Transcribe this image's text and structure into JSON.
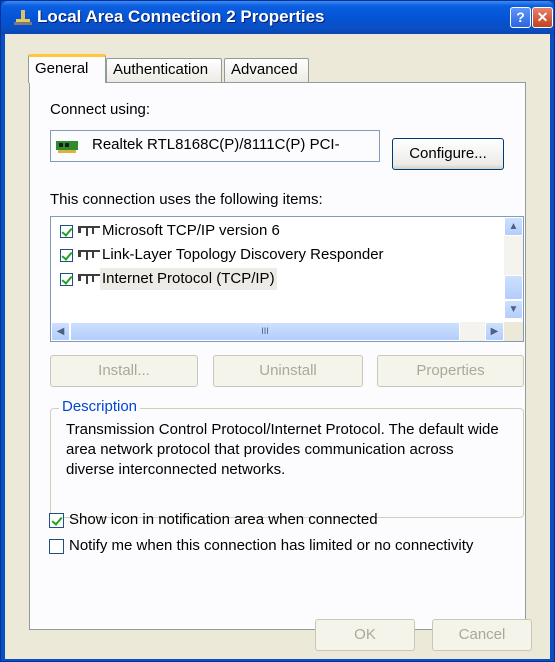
{
  "window": {
    "title": "Local Area Connection 2 Properties",
    "help_label": "?",
    "close_label": "✕"
  },
  "tabs": [
    {
      "label": "General",
      "active": true
    },
    {
      "label": "Authentication",
      "active": false
    },
    {
      "label": "Advanced",
      "active": false
    }
  ],
  "general": {
    "connect_using_label": "Connect using:",
    "device_name": "Realtek RTL8168C(P)/8111C(P) PCI-",
    "configure_label": "Configure...",
    "items_label": "This connection uses the following items:",
    "items": [
      {
        "label": "Microsoft TCP/IP version 6",
        "checked": true,
        "icon": "network-protocol-icon"
      },
      {
        "label": "Link-Layer Topology Discovery Responder",
        "checked": true,
        "icon": "network-protocol-icon"
      },
      {
        "label": "Internet Protocol (TCP/IP)",
        "checked": true,
        "icon": "network-protocol-icon",
        "selected": true
      }
    ],
    "scroll_thumb_text": "III",
    "install_label": "Install...",
    "uninstall_label": "Uninstall",
    "properties_label": "Properties",
    "description_title": "Description",
    "description_text": "Transmission Control Protocol/Internet Protocol. The default wide area network protocol that provides communication across diverse interconnected networks.",
    "show_icon_label": "Show icon in notification area when connected",
    "show_icon_checked": true,
    "notify_label": "Notify me when this connection has limited or no connectivity",
    "notify_checked": false
  },
  "footer": {
    "ok_label": "OK",
    "cancel_label": "Cancel"
  },
  "colors": {
    "title_bar": "#0a4ec2",
    "accent_tab": "#ffc83c",
    "check": "#21a121",
    "selection": "#ecebe6"
  }
}
